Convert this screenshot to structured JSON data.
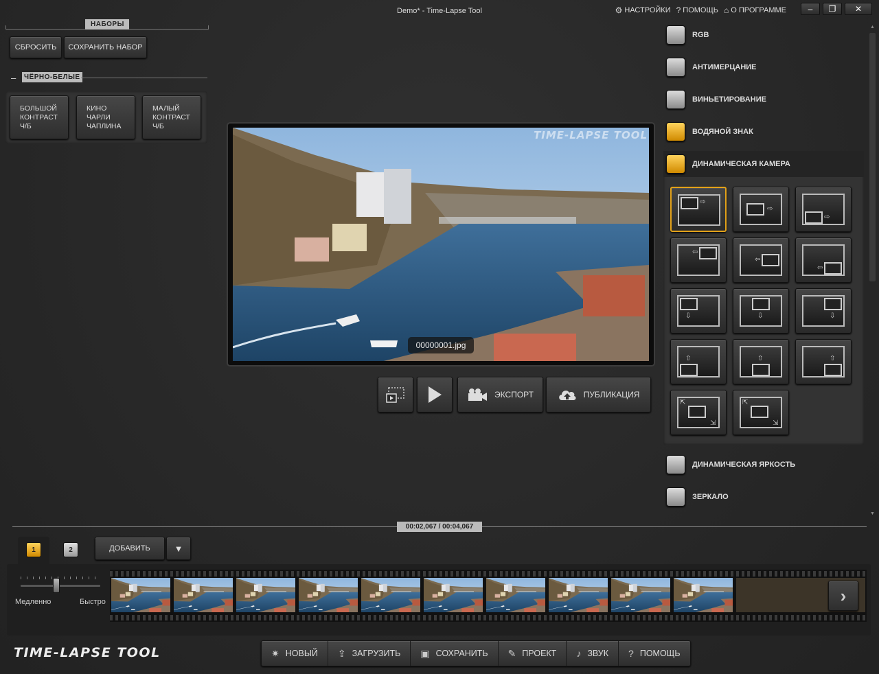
{
  "window": {
    "title": "Demo* - Time-Lapse Tool",
    "links": [
      {
        "icon": "gear-icon",
        "glyph": "⚙",
        "label": "НАСТРОЙКИ"
      },
      {
        "icon": "help-icon",
        "glyph": "?",
        "label": "ПОМОЩЬ"
      },
      {
        "icon": "home-icon",
        "glyph": "⌂",
        "label": "О ПРОГРАММЕ"
      }
    ],
    "controls": {
      "minimize": "–",
      "maximize": "❐",
      "close": "✕"
    }
  },
  "presets": {
    "header": "НАБОРЫ",
    "reset_label": "СБРОСИТЬ",
    "save_label": "СОХРАНИТЬ НАБОР",
    "group": {
      "toggle": "–",
      "label": "ЧЁРНО-БЕЛЫЕ",
      "items": [
        "БОЛЬШОЙ\nКОНТРАСТ\nЧ/Б",
        "КИНО\nЧАРЛИ\nЧАПЛИНА",
        "МАЛЫЙ\nКОНТРАСТ\nЧ/Б"
      ]
    }
  },
  "preview": {
    "watermark": "TIME-LAPSE TOOL",
    "frame_name": "00000001.jpg"
  },
  "player": {
    "export_label": "ЭКСПОРТ",
    "publish_label": "ПУБЛИКАЦИЯ"
  },
  "effects": {
    "items": [
      {
        "label": "RGB",
        "checked": false
      },
      {
        "label": "АНТИМЕРЦАНИЕ",
        "checked": false
      },
      {
        "label": "ВИНЬЕТИРОВАНИЕ",
        "checked": false
      },
      {
        "label": "ВОДЯНОЙ ЗНАК",
        "checked": true
      },
      {
        "label": "ДИНАМИЧЕСКАЯ КАМЕРА",
        "checked": true
      }
    ],
    "dynamic_camera_presets": [
      "pan-left-to-right",
      "zoom-left-to-right",
      "pan-bottom-left-to-right",
      "pan-right-to-left",
      "zoom-right-to-left",
      "pan-bottom-right-to-left",
      "pan-top-left-down",
      "pan-top-center-down",
      "pan-top-right-down",
      "pan-bottom-left-up",
      "pan-bottom-center-up",
      "pan-bottom-right-up",
      "zoom-in-diagonal",
      "zoom-out-diagonal"
    ],
    "selected_camera_preset": 0,
    "after": [
      {
        "label": "ДИНАМИЧЕСКАЯ ЯРКОСТЬ",
        "checked": false
      },
      {
        "label": "ЗЕРКАЛО",
        "checked": false
      }
    ]
  },
  "timeline": {
    "time": "00:02,067  /  00:04,067",
    "tracks": [
      "1",
      "2"
    ],
    "active_track": "1",
    "add_label": "ДОБАВИТЬ",
    "speed": {
      "slow_label": "Медленно",
      "fast_label": "Быстро",
      "value_fraction": 0.45
    },
    "frame_count": 10
  },
  "footer": {
    "logo": "TIME-LAPSE TOOL",
    "buttons": [
      {
        "icon": "star-icon",
        "glyph": "✷",
        "label": "НОВЫЙ"
      },
      {
        "icon": "upload-icon",
        "glyph": "⇪",
        "label": "ЗАГРУЗИТЬ"
      },
      {
        "icon": "floppy-icon",
        "glyph": "▣",
        "label": "СОХРАНИТЬ"
      },
      {
        "icon": "wrench-icon",
        "glyph": "✎",
        "label": "ПРОЕКТ"
      },
      {
        "icon": "note-icon",
        "glyph": "♪",
        "label": "ЗВУК"
      },
      {
        "icon": "question-icon",
        "glyph": "?",
        "label": "ПОМОЩЬ"
      }
    ]
  }
}
